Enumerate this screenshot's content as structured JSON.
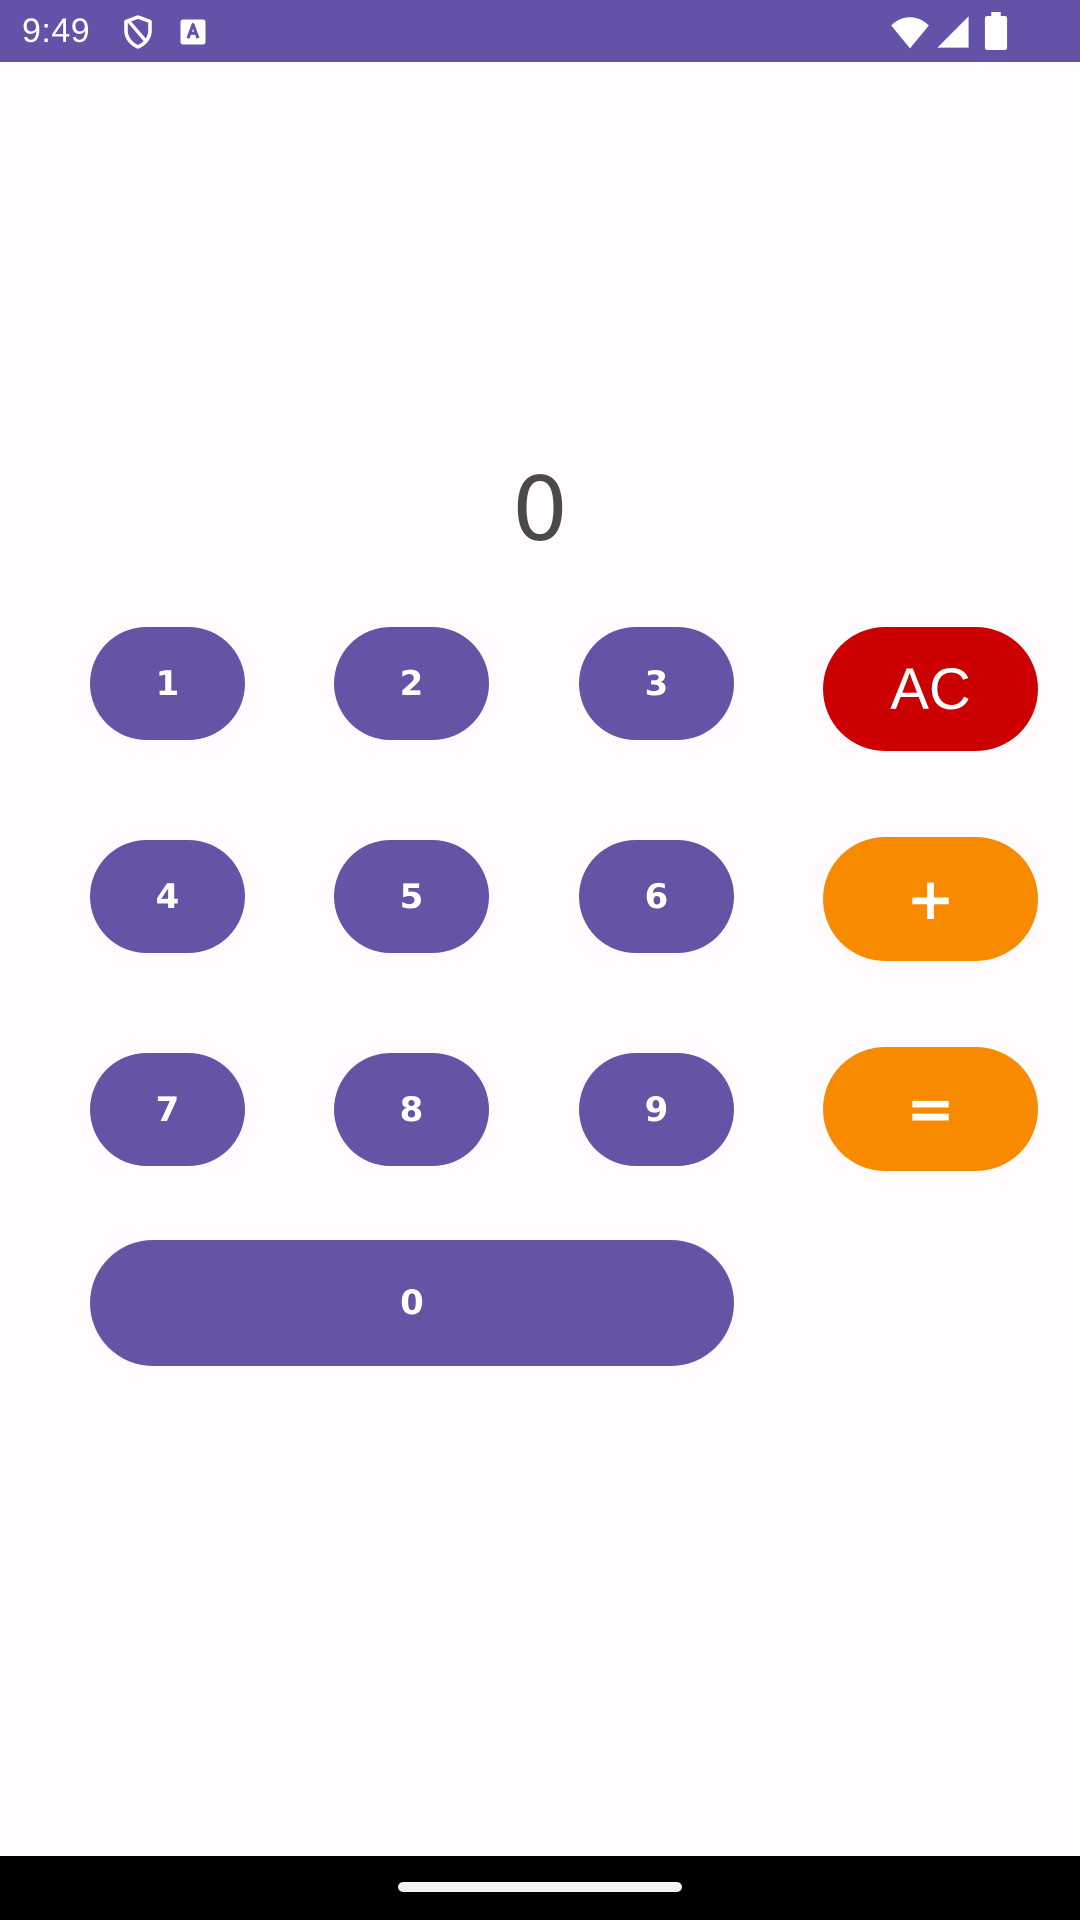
{
  "status_bar": {
    "time": "9:49",
    "color": "#6452a8",
    "icons": [
      "shield-icon",
      "text-recognition-icon",
      "wifi-icon",
      "signal-icon",
      "battery-icon"
    ]
  },
  "display": {
    "value": "0"
  },
  "keypad": {
    "digits": {
      "k1": "1",
      "k2": "2",
      "k3": "3",
      "k4": "4",
      "k5": "5",
      "k6": "6",
      "k7": "7",
      "k8": "8",
      "k9": "9",
      "k0": "0"
    },
    "clear_label": "AC",
    "plus_label": "+",
    "equals_label": "=",
    "colors": {
      "digit": "#6553a6",
      "clear": "#cc0000",
      "operator": "#f88a00"
    }
  }
}
